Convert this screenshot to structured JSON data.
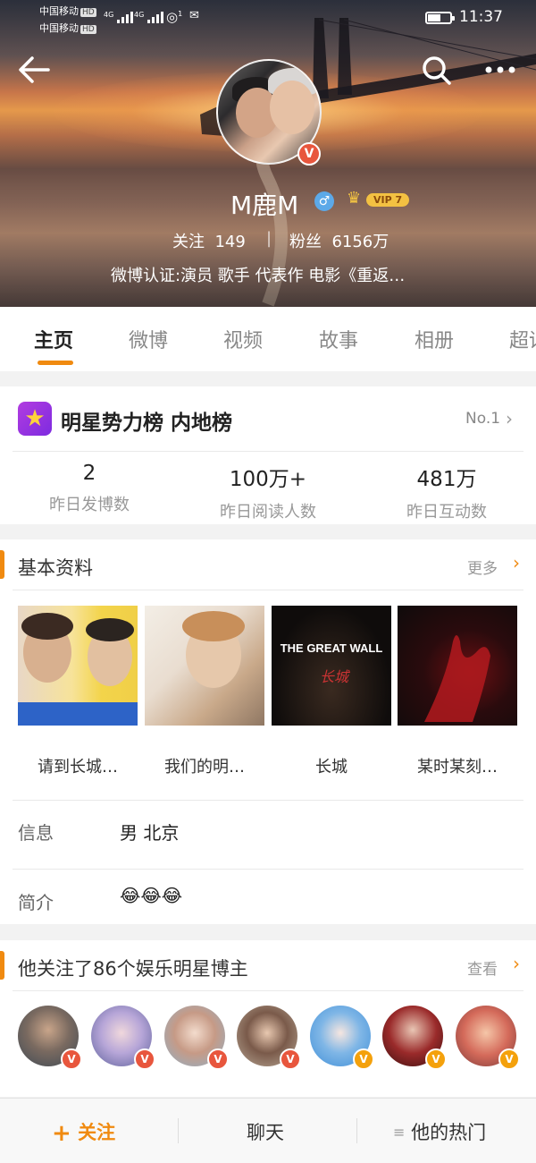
{
  "status_bar": {
    "carrier_1": "中国移动",
    "carrier_2": "中国移动",
    "hd_label": "HD",
    "network_1": "4G",
    "network_2": "4G",
    "wifi_extra": "1",
    "time": "11:37"
  },
  "nav": {
    "back_icon": "back-arrow-icon",
    "search_icon": "search-icon",
    "more_icon": "more-icon"
  },
  "profile": {
    "name": "M鹿M",
    "gender_symbol": "♂",
    "vip_label": "VIP 7",
    "verified_badge": "V",
    "follow_label": "关注",
    "follow_count": "149",
    "separator": "|",
    "fans_label": "粉丝",
    "fans_count": "6156万",
    "verification": "微博认证:演员 歌手 代表作 电影《重返…"
  },
  "tabs": [
    {
      "label": "主页",
      "active": true
    },
    {
      "label": "微博",
      "active": false
    },
    {
      "label": "视频",
      "active": false
    },
    {
      "label": "故事",
      "active": false
    },
    {
      "label": "相册",
      "active": false
    },
    {
      "label": "超话",
      "active": false
    }
  ],
  "rank": {
    "title": "明星势力榜 内地榜",
    "position": "No.1",
    "stats": [
      {
        "value": "2",
        "label": "昨日发博数"
      },
      {
        "value": "100万+",
        "label": "昨日阅读人数"
      },
      {
        "value": "481万",
        "label": "昨日互动数"
      }
    ]
  },
  "basic_info": {
    "title": "基本资料",
    "more_label": "更多",
    "works": [
      {
        "caption": "请到长城…"
      },
      {
        "caption": "我们的明…"
      },
      {
        "caption": "长城",
        "poster_text": "THE GREAT WALL"
      },
      {
        "caption": "某时某刻…"
      }
    ],
    "info_label": "信息",
    "info_value": "男 北京",
    "bio_label": "简介",
    "bio_value": "😂😂😂"
  },
  "following": {
    "title": "他关注了86个娱乐明星博主",
    "view_label": "查看",
    "avatars": [
      {
        "badge": "V",
        "badge_color": "#e8563d"
      },
      {
        "badge": "V",
        "badge_color": "#e8563d"
      },
      {
        "badge": "V",
        "badge_color": "#e8563d"
      },
      {
        "badge": "V",
        "badge_color": "#e8563d"
      },
      {
        "badge": "V",
        "badge_color": "#f4a10c"
      },
      {
        "badge": "V",
        "badge_color": "#f4a10c"
      },
      {
        "badge": "V",
        "badge_color": "#f4a10c"
      }
    ]
  },
  "bottom_bar": {
    "follow_label": "关注",
    "chat_label": "聊天",
    "hot_label": "他的热门"
  },
  "colors": {
    "accent": "#f08a10",
    "verified_orange": "#f4a10c",
    "verified_red": "#e8563d",
    "gender_blue": "#5ca9e8"
  }
}
